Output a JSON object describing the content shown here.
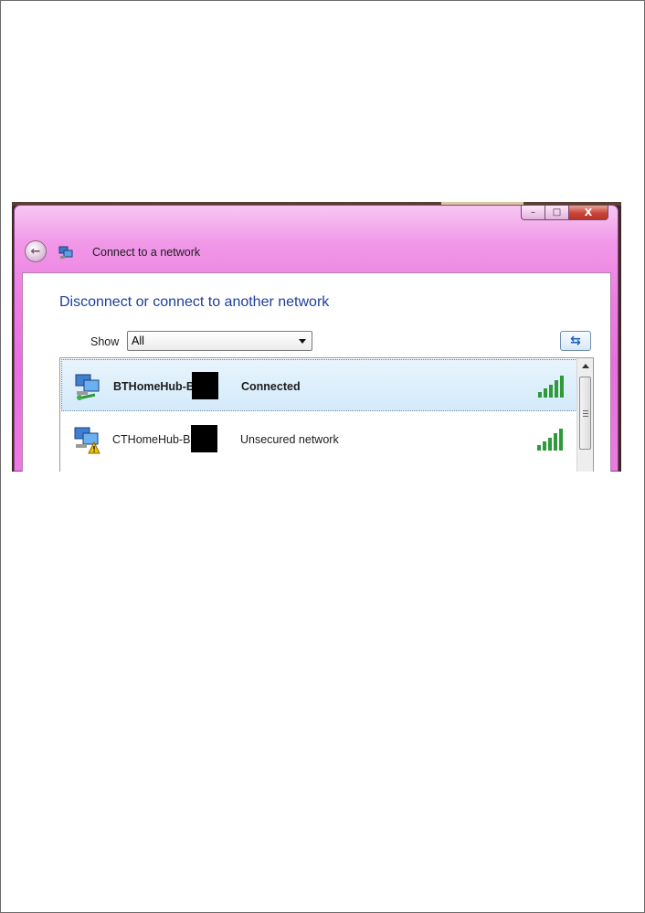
{
  "window": {
    "title": "Connect to a network",
    "caption_min": "–",
    "caption_max": "□",
    "caption_close": "X"
  },
  "main": {
    "heading": "Disconnect or connect to another network",
    "show_label": "Show",
    "show_selected": "All"
  },
  "networks": [
    {
      "name": "BTHomeHub-B",
      "status": "Connected",
      "signal_bars": 5,
      "icon": "connected-network-icon"
    },
    {
      "name": "CTHomeHub-B",
      "status": "Unsecured network",
      "signal_bars": 5,
      "icon": "unsecured-network-icon"
    }
  ],
  "colors": {
    "titlebar": "#ea7be0",
    "heading": "#1e3f9a",
    "selected_row": "#d3eafa",
    "signal": "#2e9a3a"
  }
}
